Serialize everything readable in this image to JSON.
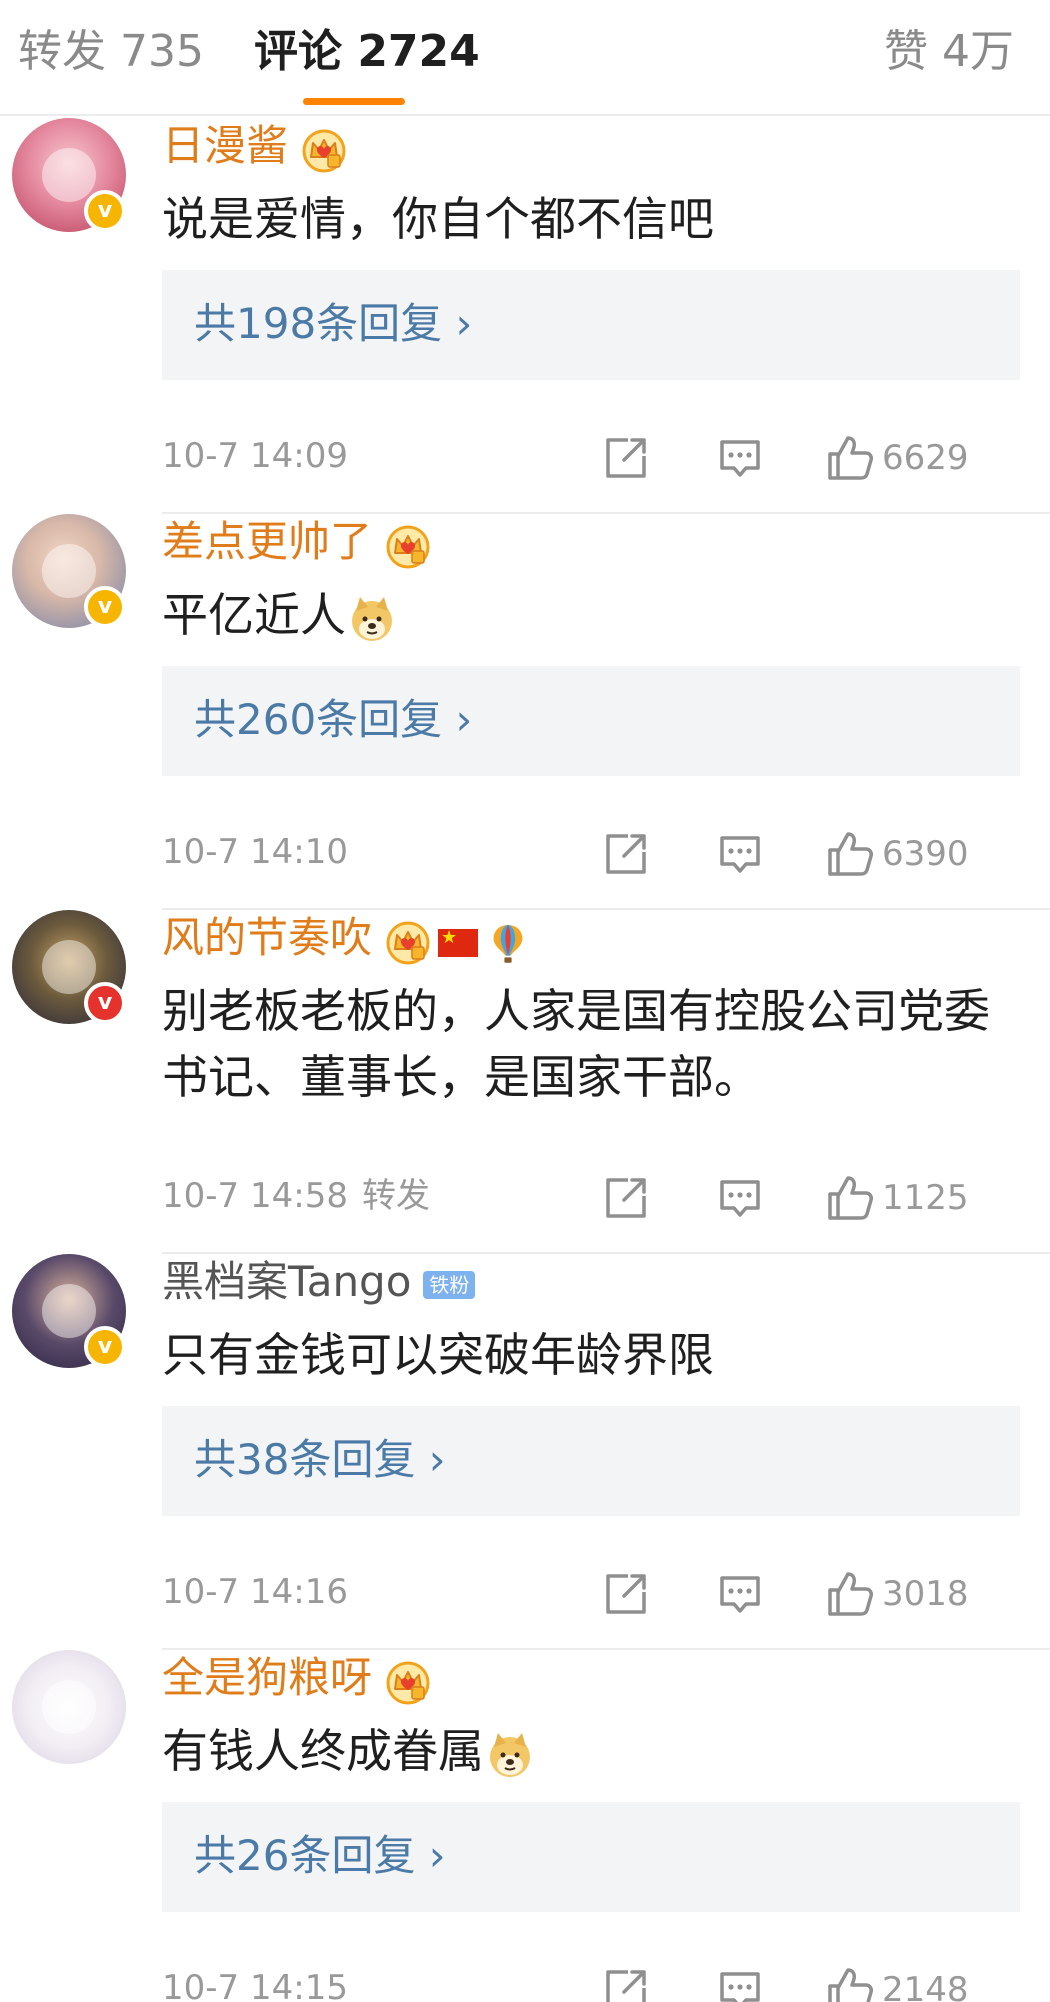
{
  "tabs": {
    "reposts": "转发 735",
    "comments": "评论 2724",
    "likes": "赞 4万"
  },
  "colors": {
    "accent": "#ff8200",
    "username_vip": "#e07c1a",
    "reply_link": "#4c7aa6",
    "meta_gray": "#999999"
  },
  "comments": [
    {
      "username": "日漫酱",
      "text": "说是爱情，你自个都不信吧",
      "replies": "共198条回复 ›",
      "time": "10-7 14:09",
      "likes": "6629",
      "verify": "yellow-v",
      "badges": [
        "crown-badge"
      ]
    },
    {
      "username": "差点更帅了",
      "text": "平亿近人",
      "emoji": "doge-emoji",
      "replies": "共260条回复 ›",
      "time": "10-7 14:10",
      "likes": "6390",
      "verify": "yellow-v",
      "badges": [
        "crown-badge"
      ]
    },
    {
      "username": "风的节奏吹",
      "text": "别老板老板的，人家是国有控股公司党委书记、董事长，是国家干部。",
      "time": "10-7 14:58",
      "repost_flag": "转发",
      "likes": "1125",
      "verify": "red-v",
      "badges": [
        "crown-badge",
        "china-flag-icon",
        "balloon-icon"
      ]
    },
    {
      "username": "黑档案Tango",
      "fan_badge": "铁粉",
      "text": "只有金钱可以突破年龄界限",
      "replies": "共38条回复 ›",
      "time": "10-7 14:16",
      "likes": "3018",
      "verify": "yellow-v"
    },
    {
      "username": "全是狗粮呀",
      "text": "有钱人终成眷属",
      "emoji": "doge-emoji",
      "replies": "共26条回复 ›",
      "time": "10-7 14:15",
      "likes": "2148",
      "badges": [
        "crown-badge"
      ]
    }
  ]
}
